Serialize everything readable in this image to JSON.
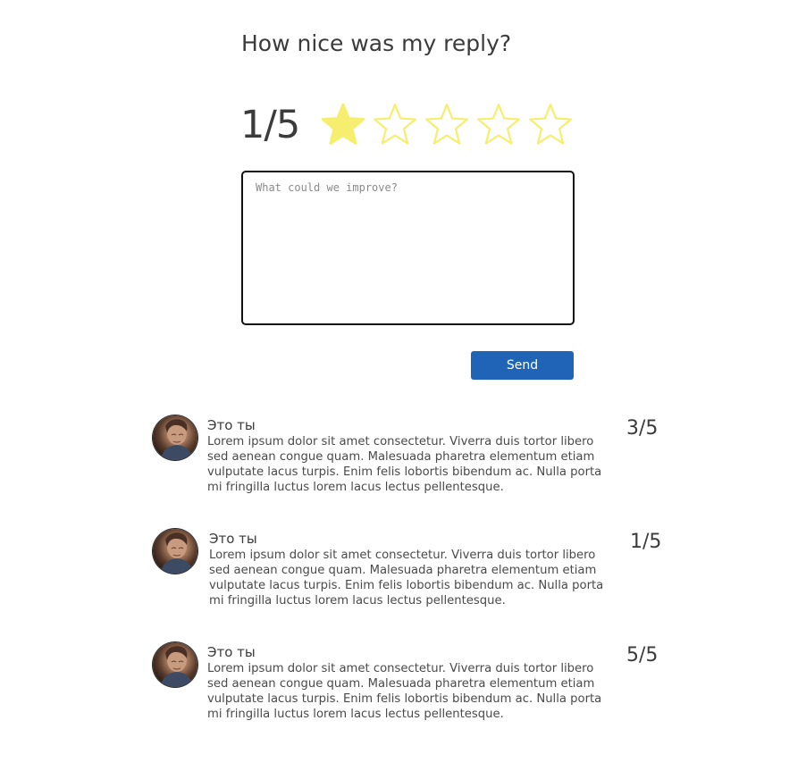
{
  "header": {
    "title": "How nice was my reply?"
  },
  "rating": {
    "value_text": "1/5",
    "value": 1,
    "max": 5,
    "filled_color": "#f5ee6e",
    "outline_color": "#f5ee6e"
  },
  "feedback": {
    "placeholder": "What could we improve?",
    "value": ""
  },
  "actions": {
    "send_label": "Send",
    "send_color": "#1f64b7"
  },
  "reviews": [
    {
      "author": "Это ты",
      "body": "Lorem ipsum dolor sit amet consectetur. Viverra duis tortor libero sed aenean congue quam. Malesuada pharetra elementum etiam vulputate lacus turpis. Enim felis lobortis bibendum ac. Nulla porta mi fringilla luctus lorem lacus lectus pellentesque.",
      "score": "3/5"
    },
    {
      "author": "Это ты",
      "body": "Lorem ipsum dolor sit amet consectetur. Viverra duis tortor libero sed aenean congue quam. Malesuada pharetra elementum etiam vulputate lacus turpis. Enim felis lobortis bibendum ac. Nulla porta mi fringilla luctus lorem lacus lectus pellentesque.",
      "score": "1/5"
    },
    {
      "author": "Это ты",
      "body": "Lorem ipsum dolor sit amet consectetur. Viverra duis tortor libero sed aenean congue quam. Malesuada pharetra elementum etiam vulputate lacus turpis. Enim felis lobortis bibendum ac. Nulla porta mi fringilla luctus lorem lacus lectus pellentesque.",
      "score": "5/5"
    }
  ]
}
